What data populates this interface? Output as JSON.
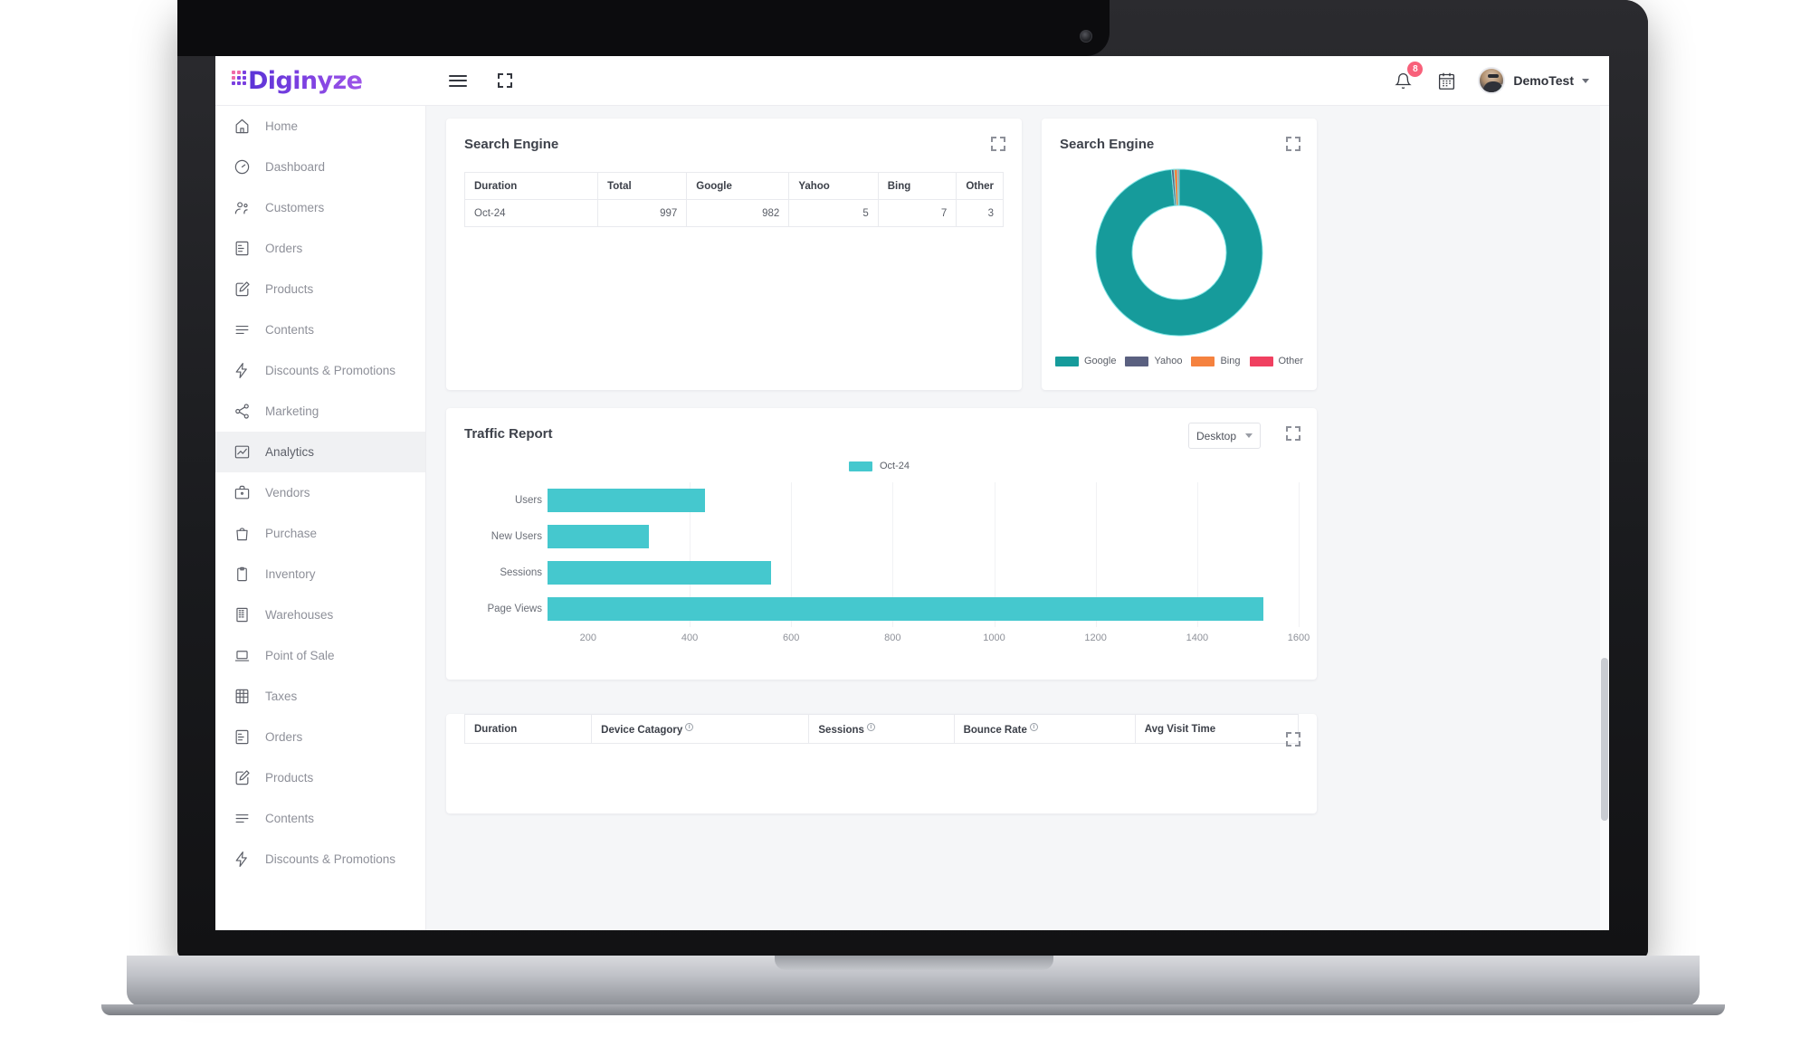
{
  "app": {
    "logo_text": "Diginyze",
    "user_name": "DemoTest",
    "notification_count": "8"
  },
  "icons": {
    "hamburger": "hamburger-icon",
    "expand": "fullscreen-expand-icon",
    "bell": "notification-bell-icon",
    "calendar": "calendar-icon"
  },
  "sidebar": {
    "items": [
      {
        "label": "Home",
        "icon": "home-icon",
        "active": false
      },
      {
        "label": "Dashboard",
        "icon": "dashboard-gauge-icon",
        "active": false
      },
      {
        "label": "Customers",
        "icon": "customers-people-icon",
        "active": false
      },
      {
        "label": "Orders",
        "icon": "orders-clipboard-icon",
        "active": false
      },
      {
        "label": "Products",
        "icon": "products-edit-icon",
        "active": false
      },
      {
        "label": "Contents",
        "icon": "contents-lines-icon",
        "active": false
      },
      {
        "label": "Discounts & Promotions",
        "icon": "discounts-bolt-icon",
        "active": false
      },
      {
        "label": "Marketing",
        "icon": "marketing-share-icon",
        "active": false
      },
      {
        "label": "Analytics",
        "icon": "analytics-chart-icon",
        "active": true
      },
      {
        "label": "Vendors",
        "icon": "vendors-briefcase-icon",
        "active": false
      },
      {
        "label": "Purchase",
        "icon": "purchase-bag-icon",
        "active": false
      },
      {
        "label": "Inventory",
        "icon": "inventory-clipboard-icon",
        "active": false
      },
      {
        "label": "Warehouses",
        "icon": "warehouses-building-icon",
        "active": false
      },
      {
        "label": "Point of Sale",
        "icon": "point-of-sale-laptop-icon",
        "active": false
      },
      {
        "label": "Taxes",
        "icon": "taxes-calculator-icon",
        "active": false
      },
      {
        "label": "Orders",
        "icon": "orders-clipboard-icon",
        "active": false
      },
      {
        "label": "Products",
        "icon": "products-edit-icon",
        "active": false
      },
      {
        "label": "Contents",
        "icon": "contents-lines-icon",
        "active": false
      },
      {
        "label": "Discounts & Promotions",
        "icon": "discounts-bolt-icon",
        "active": false
      }
    ]
  },
  "search_engine_card": {
    "title": "Search Engine",
    "columns": [
      "Duration",
      "Total",
      "Google",
      "Yahoo",
      "Bing",
      "Other"
    ],
    "rows": [
      {
        "duration": "Oct-24",
        "total": "997",
        "google": "982",
        "yahoo": "5",
        "bing": "7",
        "other": "3"
      }
    ]
  },
  "donut_card": {
    "title": "Search Engine"
  },
  "traffic_report": {
    "title": "Traffic Report",
    "device_filter": "Desktop",
    "series_legend": "Oct-24"
  },
  "device_table": {
    "columns": [
      {
        "label": "Duration",
        "info": false
      },
      {
        "label": "Device Catagory",
        "info": true
      },
      {
        "label": "Sessions",
        "info": true
      },
      {
        "label": "Bounce Rate",
        "info": true
      },
      {
        "label": "Avg Visit Time",
        "info": false
      }
    ]
  },
  "colors": {
    "google": "#169b9b",
    "yahoo": "#5a6080",
    "bing": "#f58košt",
    "bing_fix": "#f5823f",
    "other": "#f04060",
    "bar": "#45c8ce",
    "brand": "#7a3fe0"
  },
  "chart_data": [
    {
      "type": "bar",
      "title": "Traffic Report",
      "orientation": "horizontal",
      "categories": [
        "Users",
        "New Users",
        "Sessions",
        "Page Views"
      ],
      "series": [
        {
          "name": "Oct-24",
          "values": [
            430,
            320,
            560,
            1530
          ],
          "color": "#45c8ce"
        }
      ],
      "xlabel": "",
      "ylabel": "",
      "xlim": [
        120,
        1600
      ],
      "xticks": [
        200,
        400,
        600,
        800,
        1000,
        1200,
        1400,
        1600
      ],
      "grid": true,
      "legend_position": "top-center"
    },
    {
      "type": "pie",
      "subtype": "donut",
      "title": "Search Engine",
      "labels": [
        "Google",
        "Yahoo",
        "Bing",
        "Other"
      ],
      "values": [
        982,
        5,
        7,
        3
      ],
      "colors": [
        "#169b9b",
        "#5a6080",
        "#f5823f",
        "#f04060"
      ],
      "legend_position": "bottom",
      "hole": 0.56
    },
    {
      "type": "table",
      "title": "Search Engine",
      "columns": [
        "Duration",
        "Total",
        "Google",
        "Yahoo",
        "Bing",
        "Other"
      ],
      "rows": [
        [
          "Oct-24",
          "997",
          "982",
          "5",
          "7",
          "3"
        ]
      ]
    }
  ]
}
